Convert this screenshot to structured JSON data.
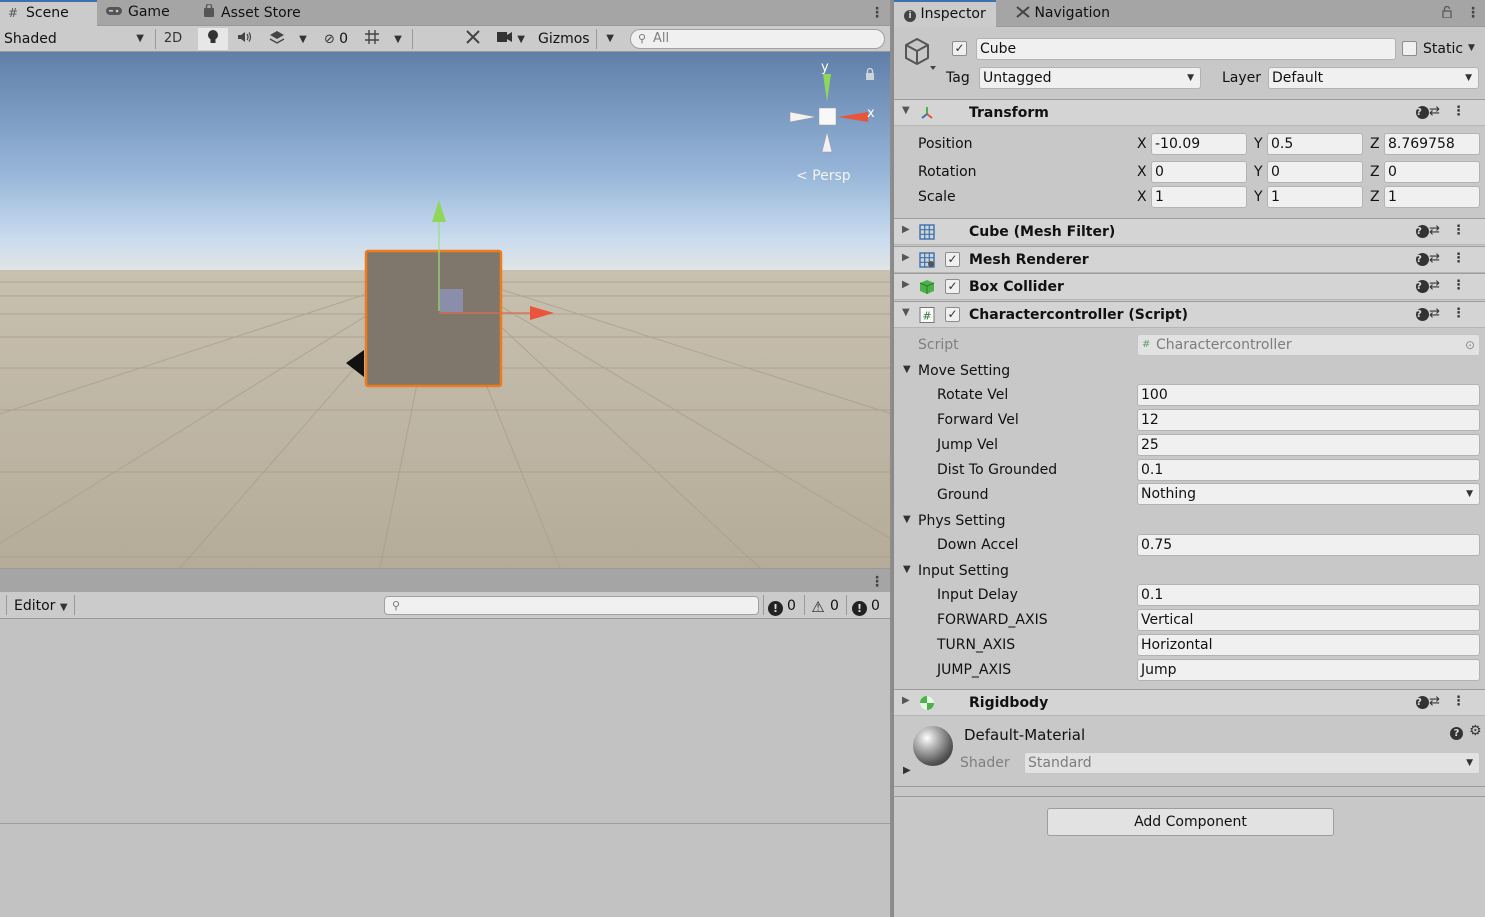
{
  "scene_tabs": {
    "scene": "Scene",
    "game": "Game",
    "asset_store": "Asset Store"
  },
  "scene_toolbar": {
    "shading_mode": "Shaded",
    "mode_2d": "2D",
    "hidden_count": "0",
    "gizmos": "Gizmos",
    "search_placeholder": "All"
  },
  "viewport": {
    "gizmo_y": "y",
    "gizmo_x": "x",
    "projection": "Persp"
  },
  "console": {
    "editor_dropdown": "Editor",
    "log_count": "0",
    "warning_count": "0",
    "error_count": "0"
  },
  "inspector_tabs": {
    "inspector": "Inspector",
    "navigation": "Navigation"
  },
  "gameobject": {
    "name": "Cube",
    "active": true,
    "static_label": "Static",
    "tag_label": "Tag",
    "tag_value": "Untagged",
    "layer_label": "Layer",
    "layer_value": "Default"
  },
  "transform": {
    "title": "Transform",
    "position_label": "Position",
    "rotation_label": "Rotation",
    "scale_label": "Scale",
    "axis_x": "X",
    "axis_y": "Y",
    "axis_z": "Z",
    "position": {
      "x": "-10.09",
      "y": "0.5",
      "z": "8.769758"
    },
    "rotation": {
      "x": "0",
      "y": "0",
      "z": "0"
    },
    "scale": {
      "x": "1",
      "y": "1",
      "z": "1"
    }
  },
  "components": {
    "mesh_filter": "Cube (Mesh Filter)",
    "mesh_renderer": "Mesh Renderer",
    "box_collider": "Box Collider",
    "script_component": "Charactercontroller (Script)",
    "rigidbody": "Rigidbody"
  },
  "script_fields": {
    "script_label": "Script",
    "script_value": "Charactercontroller",
    "move_setting": "Move Setting",
    "rotate_vel_label": "Rotate Vel",
    "rotate_vel": "100",
    "forward_vel_label": "Forward Vel",
    "forward_vel": "12",
    "jump_vel_label": "Jump Vel",
    "jump_vel": "25",
    "dist_to_grounded_label": "Dist To Grounded",
    "dist_to_grounded": "0.1",
    "ground_label": "Ground",
    "ground": "Nothing",
    "phys_setting": "Phys Setting",
    "down_accel_label": "Down Accel",
    "down_accel": "0.75",
    "input_setting": "Input Setting",
    "input_delay_label": "Input Delay",
    "input_delay": "0.1",
    "forward_axis_label": "FORWARD_AXIS",
    "forward_axis": "Vertical",
    "turn_axis_label": "TURN_AXIS",
    "turn_axis": "Horizontal",
    "jump_axis_label": "JUMP_AXIS",
    "jump_axis": "Jump"
  },
  "material": {
    "name": "Default-Material",
    "shader_label": "Shader",
    "shader_value": "Standard"
  },
  "add_component": "Add Component",
  "colors": {
    "selection_outline": "#f07b1a",
    "accent_tab": "#3a72b0"
  }
}
